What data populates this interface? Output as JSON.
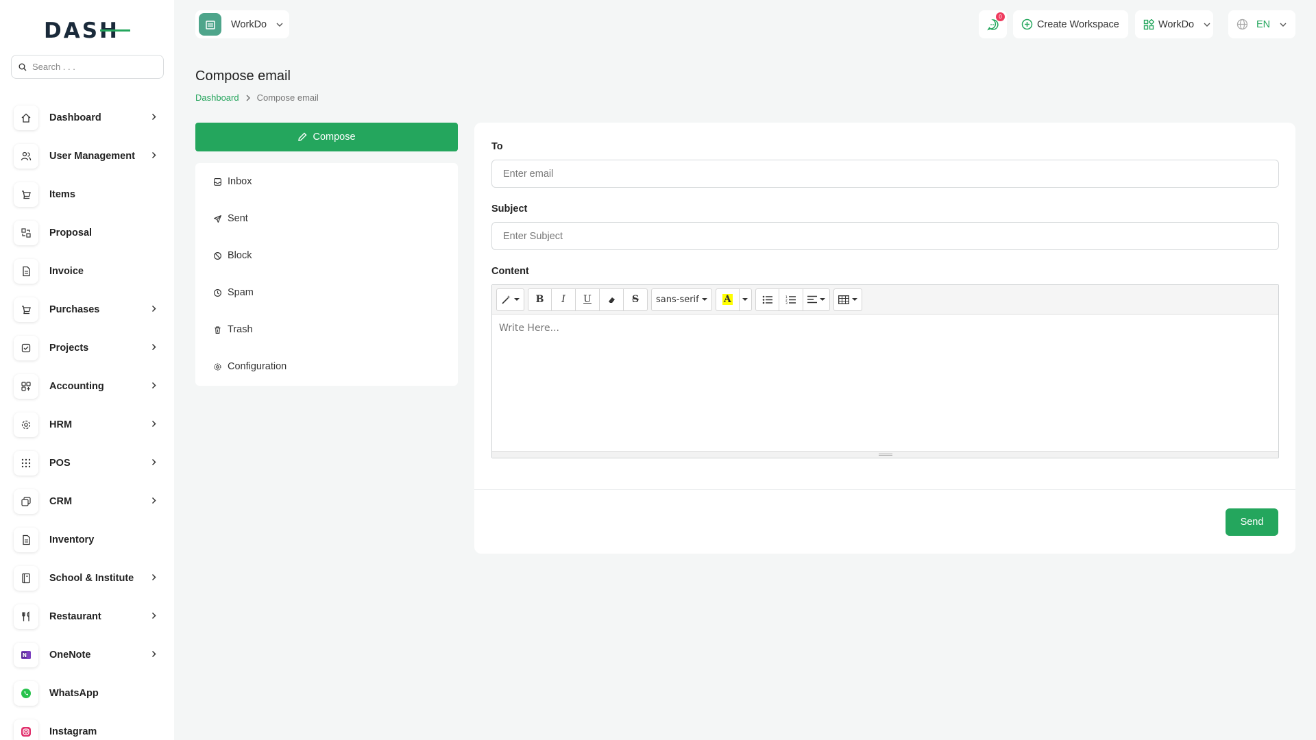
{
  "brand": {
    "logo_text": "DASH"
  },
  "search": {
    "placeholder": "Search . . ."
  },
  "sidebar": {
    "items": [
      {
        "label": "Dashboard",
        "icon": "home-icon",
        "has_children": true
      },
      {
        "label": "User Management",
        "icon": "users-icon",
        "has_children": true
      },
      {
        "label": "Items",
        "icon": "cart-icon",
        "has_children": false
      },
      {
        "label": "Proposal",
        "icon": "proposal-icon",
        "has_children": false
      },
      {
        "label": "Invoice",
        "icon": "file-icon",
        "has_children": false
      },
      {
        "label": "Purchases",
        "icon": "cart-icon",
        "has_children": true
      },
      {
        "label": "Projects",
        "icon": "checkbox-icon",
        "has_children": true
      },
      {
        "label": "Accounting",
        "icon": "grid-icon",
        "has_children": true
      },
      {
        "label": "HRM",
        "icon": "hrm-icon",
        "has_children": true
      },
      {
        "label": "POS",
        "icon": "dots-grid-icon",
        "has_children": true
      },
      {
        "label": "CRM",
        "icon": "layers-icon",
        "has_children": true
      },
      {
        "label": "Inventory",
        "icon": "file-icon",
        "has_children": false
      },
      {
        "label": "School & Institute",
        "icon": "book-icon",
        "has_children": true
      },
      {
        "label": "Restaurant",
        "icon": "utensils-icon",
        "has_children": true
      },
      {
        "label": "OneNote",
        "icon": "onenote-icon",
        "has_children": true
      },
      {
        "label": "WhatsApp",
        "icon": "whatsapp-icon",
        "has_children": false
      },
      {
        "label": "Instagram",
        "icon": "instagram-icon",
        "has_children": false
      }
    ]
  },
  "header": {
    "workspace_name": "WorkDo",
    "notification_count": "0",
    "create_workspace_label": "Create Workspace",
    "company_name": "WorkDo",
    "language": "EN"
  },
  "page": {
    "title": "Compose email",
    "breadcrumb": {
      "home": "Dashboard",
      "current": "Compose email"
    }
  },
  "mail": {
    "compose_label": "Compose",
    "folders": [
      {
        "label": "Inbox",
        "icon": "inbox-icon"
      },
      {
        "label": "Sent",
        "icon": "send-icon"
      },
      {
        "label": "Block",
        "icon": "block-icon"
      },
      {
        "label": "Spam",
        "icon": "spam-icon"
      },
      {
        "label": "Trash",
        "icon": "trash-icon"
      },
      {
        "label": "Configuration",
        "icon": "gear-icon"
      }
    ]
  },
  "form": {
    "to_label": "To",
    "to_placeholder": "Enter email",
    "subject_label": "Subject",
    "subject_placeholder": "Enter Subject",
    "content_label": "Content",
    "editor_placeholder": "Write Here...",
    "font_name": "sans-serif",
    "send_label": "Send"
  },
  "colors": {
    "accent": "#24a65d",
    "badge": "#ef3b5e",
    "workspace_logo": "#4ea58b"
  }
}
